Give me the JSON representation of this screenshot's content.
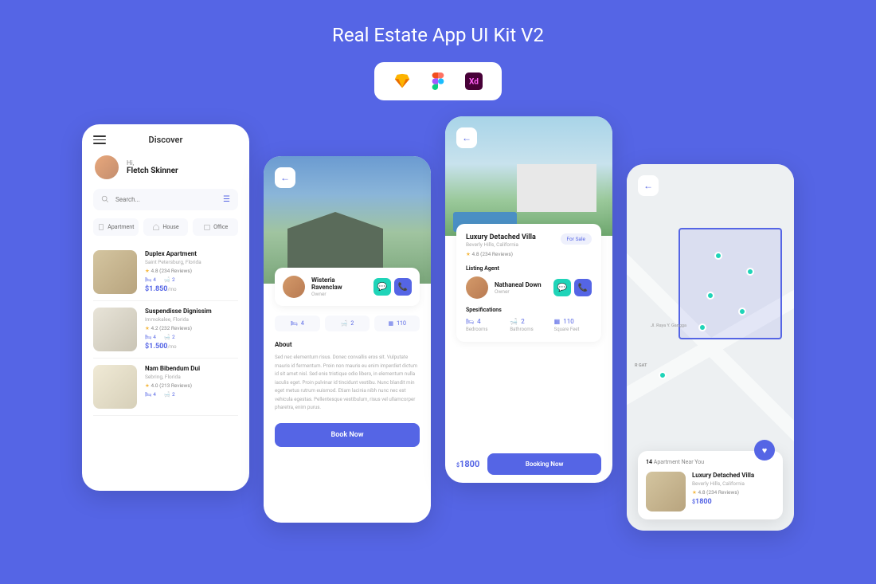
{
  "title": "Real Estate App UI Kit V2",
  "tools": [
    "sketch",
    "figma",
    "xd"
  ],
  "discover": {
    "header": "Discover",
    "greeting": "Hi,",
    "username": "Fletch Skinner",
    "search_placeholder": "Search...",
    "categories": [
      {
        "icon": "building",
        "label": "Apartment"
      },
      {
        "icon": "house",
        "label": "House"
      },
      {
        "icon": "office",
        "label": "Office"
      }
    ],
    "listings": [
      {
        "title": "Duplex Apartment",
        "location": "Saint Petersburg, Florida",
        "rating": "4.8",
        "reviews": "234",
        "beds": "4",
        "baths": "2",
        "price": "$1.850",
        "period": "/mo"
      },
      {
        "title": "Suspendisse Dignissim",
        "location": "Immokalee, Florida",
        "rating": "4.2",
        "reviews": "232",
        "beds": "4",
        "baths": "2",
        "price": "$1.500",
        "period": "/mo"
      },
      {
        "title": "Nam Bibendum Dui",
        "location": "Sebring, Florida",
        "rating": "4.0",
        "reviews": "213",
        "beds": "4",
        "baths": "2",
        "price": "",
        "period": ""
      }
    ]
  },
  "detail": {
    "owner_name": "Wisteria Ravenclaw",
    "owner_role": "Owner",
    "specs": [
      {
        "icon": "bed",
        "value": "4"
      },
      {
        "icon": "bath",
        "value": "2"
      },
      {
        "icon": "area",
        "value": "110"
      }
    ],
    "about_title": "About",
    "about_text": "Sed nec elementum risus. Donec convallis eros sit. Vulputate mauris id fermentum. Proin non mauris eu enim imperdiet dictum id sit amet nisl. Sed enis tristique odio libero, in elementum nulla iaculis eget. Proin pulvinar id tincidunt vestibu. Nunc blandit min eget metus rutrum euismod. Etiam lacinia nibh nunc nec est vehicula egestas. Pellentesque vestibulum, risus vel ullamcorper pharetra, enim purus.",
    "book_label": "Book Now"
  },
  "villa": {
    "title": "Luxury Detached Villa",
    "location": "Beverly Hills, California",
    "badge": "For Sale",
    "rating": "4.8",
    "reviews": "234",
    "agent_label": "Listing Agent",
    "agent_name": "Nathaneal Down",
    "agent_role": "Owner",
    "spec_label": "Spesifications",
    "specs": [
      {
        "value": "4",
        "label": "Bedrooms"
      },
      {
        "value": "2",
        "label": "Bathrooms"
      },
      {
        "value": "110",
        "label": "Square Feet"
      }
    ],
    "price": "1800",
    "book_label": "Booking Now"
  },
  "map": {
    "near_count": "14",
    "near_label": "Apartment Near You",
    "roads": [
      "Jl. Raya Y. Gangga",
      "R GAT"
    ],
    "card": {
      "title": "Luxury Detached Villa",
      "location": "Beverly Hills, California",
      "rating": "4.8",
      "reviews": "234",
      "price": "1800"
    }
  }
}
